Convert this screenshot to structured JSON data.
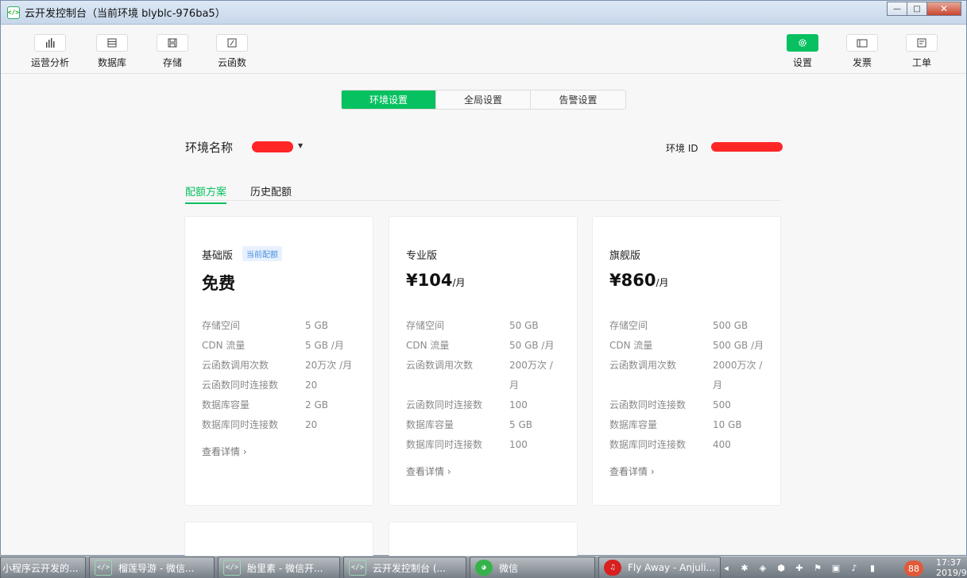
{
  "window": {
    "title": "云开发控制台（当前环境 blyblc-976ba5）"
  },
  "toolbar": {
    "left": [
      {
        "label": "运营分析",
        "icon": "bar-chart-icon"
      },
      {
        "label": "数据库",
        "icon": "database-icon"
      },
      {
        "label": "存储",
        "icon": "storage-icon"
      },
      {
        "label": "云函数",
        "icon": "cloud-function-icon"
      }
    ],
    "right": [
      {
        "label": "设置",
        "icon": "gear-icon",
        "active": true
      },
      {
        "label": "发票",
        "icon": "invoice-icon"
      },
      {
        "label": "工单",
        "icon": "ticket-icon"
      }
    ]
  },
  "tabs": [
    "环境设置",
    "全局设置",
    "告警设置"
  ],
  "env": {
    "name_label": "环境名称",
    "id_label": "环境 ID"
  },
  "subtabs": [
    "配额方案",
    "历史配额"
  ],
  "plans": [
    {
      "name": "基础版",
      "badge": "当前配额",
      "price": "免费",
      "unit": "",
      "specs": [
        [
          "存储空间",
          "5 GB"
        ],
        [
          "CDN 流量",
          "5 GB /月"
        ],
        [
          "云函数调用次数",
          "20万次 /月"
        ],
        [
          "云函数同时连接数",
          "20"
        ],
        [
          "数据库容量",
          "2 GB"
        ],
        [
          "数据库同时连接数",
          "20"
        ]
      ],
      "more": "查看详情 ›"
    },
    {
      "name": "专业版",
      "badge": "",
      "price": "¥104",
      "unit": "/月",
      "specs": [
        [
          "存储空间",
          "50 GB"
        ],
        [
          "CDN 流量",
          "50 GB /月"
        ],
        [
          "云函数调用次数",
          "200万次 /月"
        ],
        [
          "云函数同时连接数",
          "100"
        ],
        [
          "数据库容量",
          "5 GB"
        ],
        [
          "数据库同时连接数",
          "100"
        ]
      ],
      "more": "查看详情 ›"
    },
    {
      "name": "旗舰版",
      "badge": "",
      "price": "¥860",
      "unit": "/月",
      "specs": [
        [
          "存储空间",
          "500 GB"
        ],
        [
          "CDN 流量",
          "500 GB /月"
        ],
        [
          "云函数调用次数",
          "2000万次 /月"
        ],
        [
          "云函数同时连接数",
          "500"
        ],
        [
          "数据库容量",
          "10 GB"
        ],
        [
          "数据库同时连接数",
          "400"
        ]
      ],
      "more": "查看详情 ›"
    }
  ],
  "taskbar": {
    "tasks": [
      "小程序云开发的...",
      "榴莲导游 - 微信...",
      "胎里素 - 微信开...",
      "云开发控制台 (...",
      "微信",
      "Fly Away - Anjuli..."
    ],
    "badge": "88",
    "clock_time": "17:37",
    "clock_date": "2019/9"
  },
  "colors": {
    "accent": "#07c160",
    "redact": "#ff2626"
  }
}
